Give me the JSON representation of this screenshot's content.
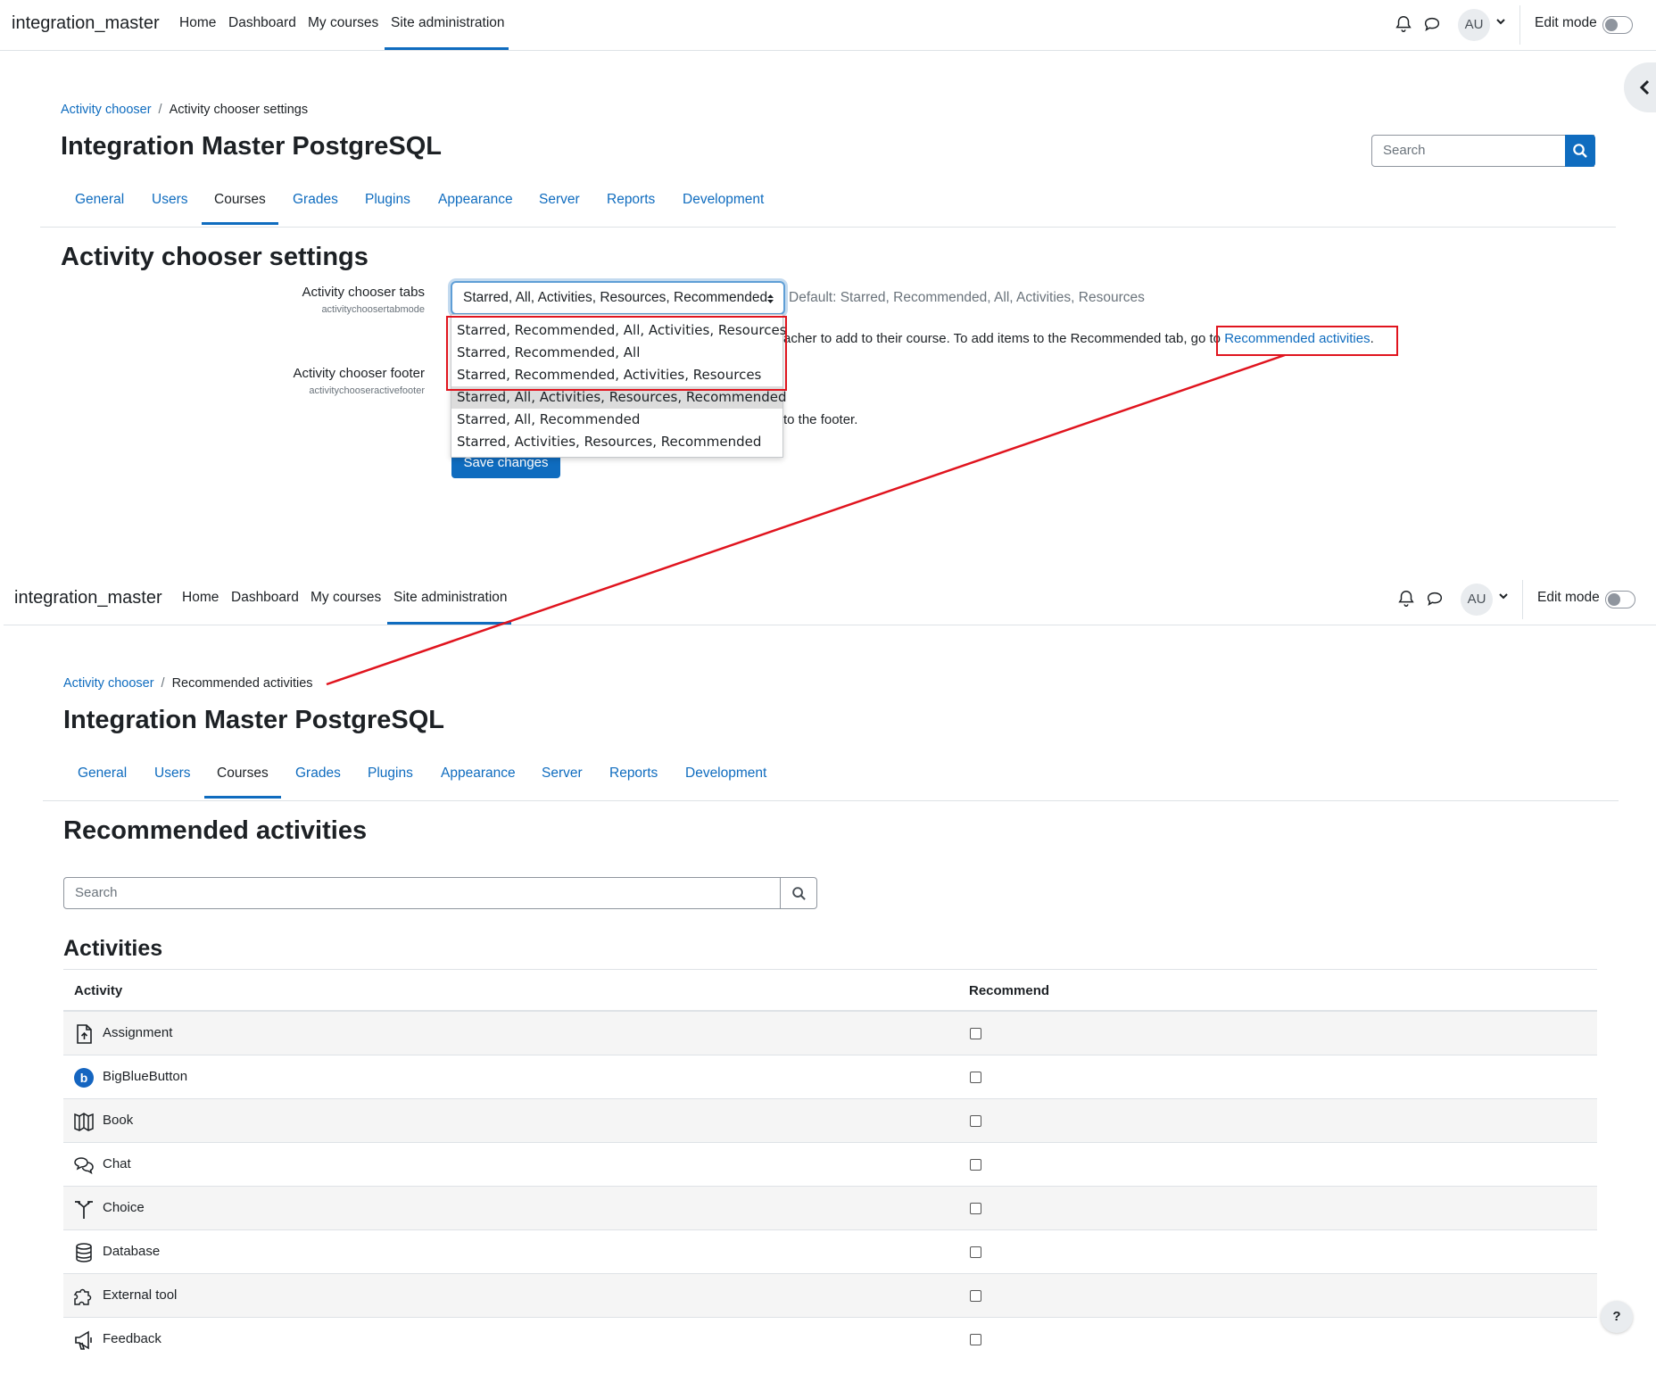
{
  "top_screen": {
    "navbar": {
      "brand": "integration_master",
      "links": [
        "Home",
        "Dashboard",
        "My courses",
        "Site administration"
      ],
      "avatar_initials": "AU",
      "edit_mode_label": "Edit mode"
    },
    "breadcrumb": {
      "parent": "Activity chooser",
      "current": "Activity chooser settings"
    },
    "site_title": "Integration Master PostgreSQL",
    "search_placeholder": "Search",
    "tabs": [
      "General",
      "Users",
      "Courses",
      "Grades",
      "Plugins",
      "Appearance",
      "Server",
      "Reports",
      "Development"
    ],
    "active_tab": "Courses",
    "section_title": "Activity chooser settings",
    "settings": {
      "tabs_label": "Activity chooser tabs",
      "tabs_key": "activitychoosertabmode",
      "tabs_selected": "Starred, All, Activities, Resources, Recommended",
      "tabs_default": "Default: Starred, Recommended, All, Activities, Resources",
      "tabs_desc_visible": "acher to add to their course. To add items to the Recommended tab, go to",
      "tabs_desc_link": "Recommended activities",
      "footer_label": "Activity chooser footer",
      "footer_key": "activitychooseractivefooter",
      "footer_desc_visible": "to the footer."
    },
    "dropdown_options": [
      "Starred, Recommended, All, Activities, Resources",
      "Starred, Recommended, All",
      "Starred, Recommended, Activities, Resources",
      "Starred, All, Activities, Resources, Recommended",
      "Starred, All, Recommended",
      "Starred, Activities, Resources, Recommended"
    ],
    "save_button": "Save changes"
  },
  "bottom_screen": {
    "navbar": {
      "brand": "integration_master",
      "links": [
        "Home",
        "Dashboard",
        "My courses",
        "Site administration"
      ],
      "avatar_initials": "AU",
      "edit_mode_label": "Edit mode"
    },
    "breadcrumb": {
      "parent": "Activity chooser",
      "current": "Recommended activities"
    },
    "site_title": "Integration Master PostgreSQL",
    "tabs": [
      "General",
      "Users",
      "Courses",
      "Grades",
      "Plugins",
      "Appearance",
      "Server",
      "Reports",
      "Development"
    ],
    "active_tab": "Courses",
    "section_title": "Recommended activities",
    "search_placeholder": "Search",
    "activities_heading": "Activities",
    "table": {
      "columns": [
        "Activity",
        "Recommend"
      ],
      "rows": [
        {
          "name": "Assignment",
          "icon": "assignment-icon"
        },
        {
          "name": "BigBlueButton",
          "icon": "bigbluebutton-icon"
        },
        {
          "name": "Book",
          "icon": "book-icon"
        },
        {
          "name": "Chat",
          "icon": "chat-icon"
        },
        {
          "name": "Choice",
          "icon": "choice-icon"
        },
        {
          "name": "Database",
          "icon": "database-icon"
        },
        {
          "name": "External tool",
          "icon": "puzzle-icon"
        },
        {
          "name": "Feedback",
          "icon": "megaphone-icon"
        }
      ]
    },
    "help_button": "?"
  },
  "colors": {
    "link": "#0f6cbf",
    "annotation_red": "#e0141e",
    "selected_option": "#dcdcdc",
    "row_stripe": "#f5f5f5"
  }
}
